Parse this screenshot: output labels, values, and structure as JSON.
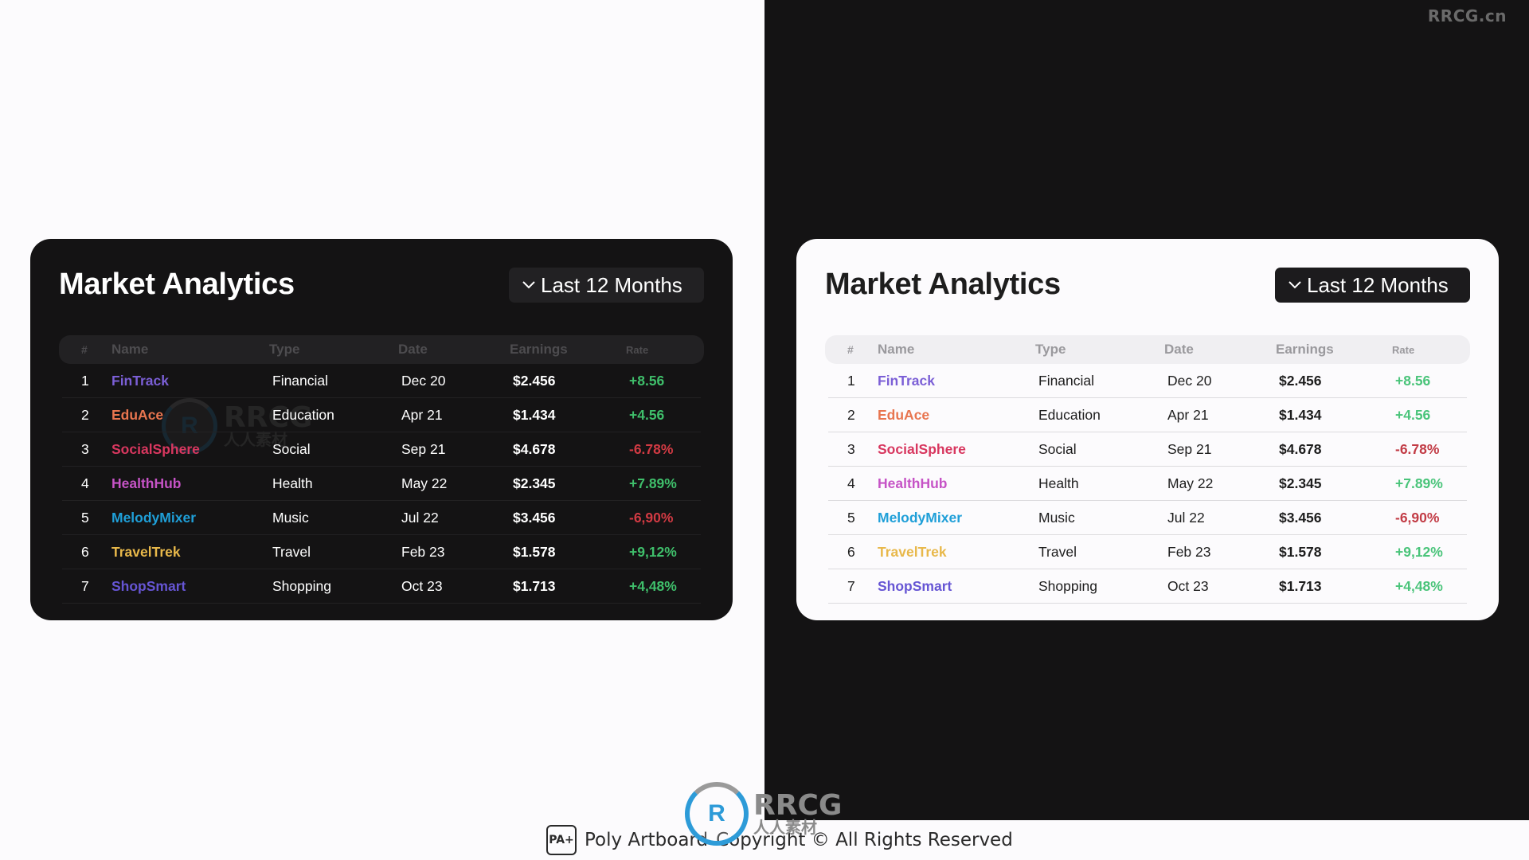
{
  "watermark": {
    "site": "RRCG.cn",
    "logo_main": "RRCG",
    "logo_sub": "人人素材"
  },
  "footer": {
    "brand_mark": "PA+",
    "brand_name": "Poly Artboard",
    "copyright": "Copyright © All Rights Reserved"
  },
  "cards": [
    {
      "theme": "dark",
      "title": "Market Analytics",
      "range_button": {
        "icon": "chevron-down-icon",
        "label": "Last 12 Months"
      },
      "columns": [
        "#",
        "Name",
        "Type",
        "Date",
        "Earnings",
        "Rate"
      ],
      "rows": [
        {
          "num": "1",
          "name": "FinTrack",
          "type": "Financial",
          "date": "Dec 20",
          "earnings": "$2.456",
          "rate": "+8.56",
          "trend": "pos"
        },
        {
          "num": "2",
          "name": "EduAce",
          "type": "Education",
          "date": "Apr 21",
          "earnings": "$1.434",
          "rate": "+4.56",
          "trend": "pos"
        },
        {
          "num": "3",
          "name": "SocialSphere",
          "type": "Social",
          "date": "Sep 21",
          "earnings": "$4.678",
          "rate": "-6.78%",
          "trend": "neg"
        },
        {
          "num": "4",
          "name": "HealthHub",
          "type": "Health",
          "date": "May 22",
          "earnings": "$2.345",
          "rate": "+7.89%",
          "trend": "pos"
        },
        {
          "num": "5",
          "name": "MelodyMixer",
          "type": "Music",
          "date": "Jul 22",
          "earnings": "$3.456",
          "rate": "-6,90%",
          "trend": "neg"
        },
        {
          "num": "6",
          "name": "TravelTrek",
          "type": "Travel",
          "date": "Feb 23",
          "earnings": "$1.578",
          "rate": "+9,12%",
          "trend": "pos"
        },
        {
          "num": "7",
          "name": "ShopSmart",
          "type": "Shopping",
          "date": "Oct 23",
          "earnings": "$1.713",
          "rate": "+4,48%",
          "trend": "pos"
        }
      ]
    },
    {
      "theme": "light",
      "title": "Market Analytics",
      "range_button": {
        "icon": "chevron-down-icon",
        "label": "Last 12 Months"
      },
      "columns": [
        "#",
        "Name",
        "Type",
        "Date",
        "Earnings",
        "Rate"
      ],
      "rows": [
        {
          "num": "1",
          "name": "FinTrack",
          "type": "Financial",
          "date": "Dec 20",
          "earnings": "$2.456",
          "rate": "+8.56",
          "trend": "pos"
        },
        {
          "num": "2",
          "name": "EduAce",
          "type": "Education",
          "date": "Apr 21",
          "earnings": "$1.434",
          "rate": "+4.56",
          "trend": "pos"
        },
        {
          "num": "3",
          "name": "SocialSphere",
          "type": "Social",
          "date": "Sep 21",
          "earnings": "$4.678",
          "rate": "-6.78%",
          "trend": "neg"
        },
        {
          "num": "4",
          "name": "HealthHub",
          "type": "Health",
          "date": "May 22",
          "earnings": "$2.345",
          "rate": "+7.89%",
          "trend": "pos"
        },
        {
          "num": "5",
          "name": "MelodyMixer",
          "type": "Music",
          "date": "Jul 22",
          "earnings": "$3.456",
          "rate": "-6,90%",
          "trend": "neg"
        },
        {
          "num": "6",
          "name": "TravelTrek",
          "type": "Travel",
          "date": "Feb 23",
          "earnings": "$1.578",
          "rate": "+9,12%",
          "trend": "pos"
        },
        {
          "num": "7",
          "name": "ShopSmart",
          "type": "Shopping",
          "date": "Oct 23",
          "earnings": "$1.713",
          "rate": "+4,48%",
          "trend": "pos"
        }
      ]
    }
  ],
  "name_colors": {
    "FinTrack": "#7b5fd6",
    "EduAce": "#e8754f",
    "SocialSphere": "#d8375f",
    "HealthHub": "#c653c6",
    "MelodyMixer": "#1f9fd8",
    "TravelTrek": "#e8b84a",
    "ShopSmart": "#6655d4"
  },
  "status_colors": {
    "positive": "#3fbf6b",
    "negative": "#d13a43"
  }
}
